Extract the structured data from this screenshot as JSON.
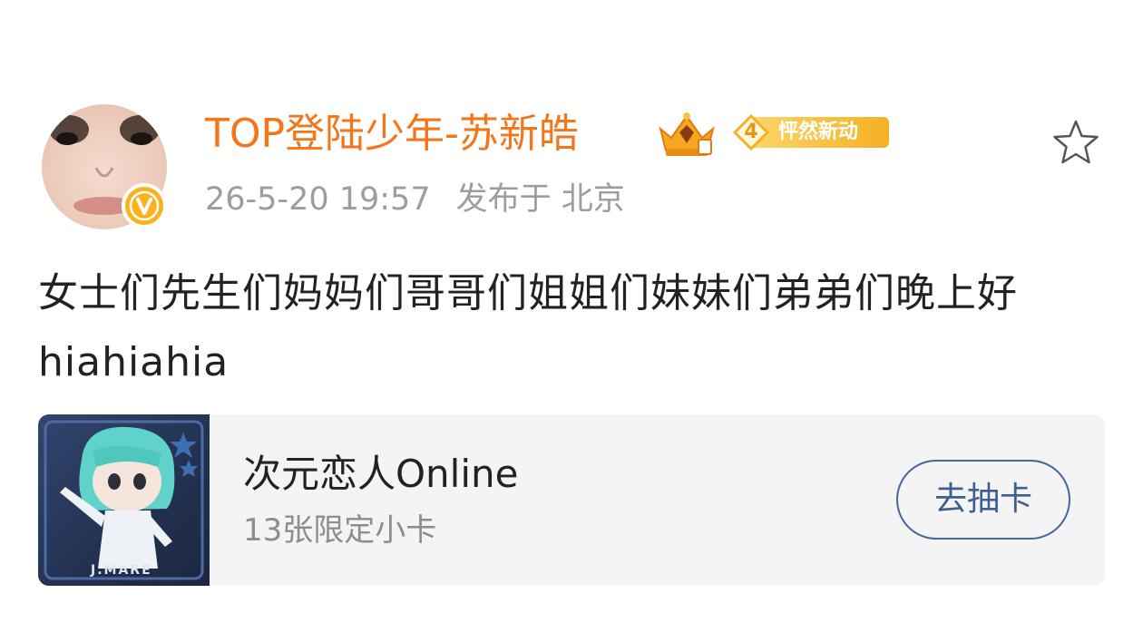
{
  "post": {
    "username": "TOP登陆少年-苏新皓",
    "level": {
      "number": "4",
      "text": "怦然新动"
    },
    "time": "26-5-20 19:57",
    "location": "发布于 北京",
    "content": "女士们先生们妈妈们哥哥们姐姐们妹妹们弟弟们晚上好 hiahiahia"
  },
  "card": {
    "title": "次元恋人Online",
    "subtitle": "13张限定小卡",
    "button_label": "去抽卡",
    "thumbnail_caption": "J.MARE"
  },
  "colors": {
    "username": "#f3761b",
    "verified_badge": "#fbb21d",
    "level_badge": "#f6b024",
    "button_border": "#46679a"
  },
  "icons": [
    "verified-v-icon",
    "crown-icon",
    "level-badge-icon",
    "star-icon"
  ]
}
